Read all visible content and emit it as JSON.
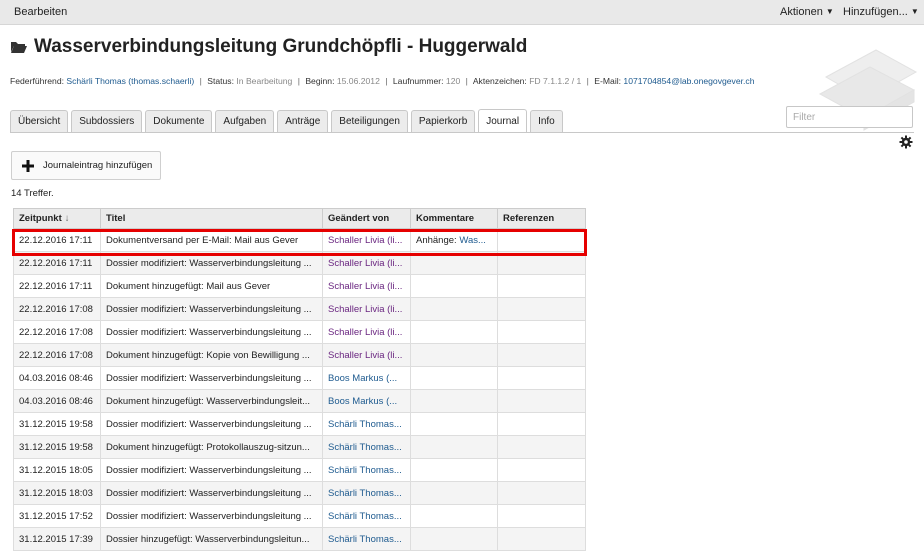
{
  "topbar": {
    "edit_label": "Bearbeiten",
    "actions_label": "Aktionen",
    "add_label": "Hinzufügen..."
  },
  "page": {
    "title": "Wasserverbindungsleitung Grundchöpfli - Huggerwald"
  },
  "meta": {
    "lead_label": "Federführend:",
    "lead_value": "Schärli Thomas (thomas.schaerli)",
    "status_label": "Status:",
    "status_value": "In Bearbeitung",
    "start_label": "Beginn:",
    "start_value": "15.06.2012",
    "number_label": "Laufnummer:",
    "number_value": "120",
    "ref_label": "Aktenzeichen:",
    "ref_value": "FD 7.1.1.2 / 1",
    "email_label": "E-Mail:",
    "email_value": "1071704854@lab.onegovgever.ch"
  },
  "tabs": [
    {
      "label": "Übersicht",
      "active": false
    },
    {
      "label": "Subdossiers",
      "active": false
    },
    {
      "label": "Dokumente",
      "active": false
    },
    {
      "label": "Aufgaben",
      "active": false
    },
    {
      "label": "Anträge",
      "active": false
    },
    {
      "label": "Beteiligungen",
      "active": false
    },
    {
      "label": "Papierkorb",
      "active": false
    },
    {
      "label": "Journal",
      "active": true
    },
    {
      "label": "Info",
      "active": false
    }
  ],
  "filter": {
    "placeholder": "Filter"
  },
  "add_button": {
    "label": "Journaleintrag hinzufügen"
  },
  "hits": "14 Treffer.",
  "table": {
    "columns": [
      "Zeitpunkt",
      "Titel",
      "Geändert von",
      "Kommentare",
      "Referenzen"
    ],
    "sort_indicator": "↓",
    "rows": [
      {
        "time": "22.12.2016 17:11",
        "title": "Dokumentversand per E-Mail: Mail aus Gever",
        "changed_by": "Schaller Livia (li...",
        "comment_label": "Anhänge:",
        "comment_link": "Was...",
        "refs": ""
      },
      {
        "time": "22.12.2016 17:11",
        "title": "Dossier modifiziert: Wasserverbindungsleitung ...",
        "changed_by": "Schaller Livia (li...",
        "comment_label": "",
        "comment_link": "",
        "refs": ""
      },
      {
        "time": "22.12.2016 17:11",
        "title": "Dokument hinzugefügt: Mail aus Gever",
        "changed_by": "Schaller Livia (li...",
        "comment_label": "",
        "comment_link": "",
        "refs": ""
      },
      {
        "time": "22.12.2016 17:08",
        "title": "Dossier modifiziert: Wasserverbindungsleitung ...",
        "changed_by": "Schaller Livia (li...",
        "comment_label": "",
        "comment_link": "",
        "refs": ""
      },
      {
        "time": "22.12.2016 17:08",
        "title": "Dossier modifiziert: Wasserverbindungsleitung ...",
        "changed_by": "Schaller Livia (li...",
        "comment_label": "",
        "comment_link": "",
        "refs": ""
      },
      {
        "time": "22.12.2016 17:08",
        "title": "Dokument hinzugefügt: Kopie von Bewilligung ...",
        "changed_by": "Schaller Livia (li...",
        "comment_label": "",
        "comment_link": "",
        "refs": ""
      },
      {
        "time": "04.03.2016 08:46",
        "title": "Dossier modifiziert: Wasserverbindungsleitung ...",
        "changed_by": "Boos Markus (...",
        "comment_label": "",
        "comment_link": "",
        "refs": ""
      },
      {
        "time": "04.03.2016 08:46",
        "title": "Dokument hinzugefügt: Wasserverbindungsleit...",
        "changed_by": "Boos Markus (...",
        "comment_label": "",
        "comment_link": "",
        "refs": ""
      },
      {
        "time": "31.12.2015 19:58",
        "title": "Dossier modifiziert: Wasserverbindungsleitung ...",
        "changed_by": "Schärli Thomas...",
        "comment_label": "",
        "comment_link": "",
        "refs": ""
      },
      {
        "time": "31.12.2015 19:58",
        "title": "Dokument hinzugefügt: Protokollauszug-sitzun...",
        "changed_by": "Schärli Thomas...",
        "comment_label": "",
        "comment_link": "",
        "refs": ""
      },
      {
        "time": "31.12.2015 18:05",
        "title": "Dossier modifiziert: Wasserverbindungsleitung ...",
        "changed_by": "Schärli Thomas...",
        "comment_label": "",
        "comment_link": "",
        "refs": ""
      },
      {
        "time": "31.12.2015 18:03",
        "title": "Dossier modifiziert: Wasserverbindungsleitung ...",
        "changed_by": "Schärli Thomas...",
        "comment_label": "",
        "comment_link": "",
        "refs": ""
      },
      {
        "time": "31.12.2015 17:52",
        "title": "Dossier modifiziert: Wasserverbindungsleitung ...",
        "changed_by": "Schärli Thomas...",
        "comment_label": "",
        "comment_link": "",
        "refs": ""
      },
      {
        "time": "31.12.2015 17:39",
        "title": "Dossier hinzugefügt: Wasserverbindungsleitun...",
        "changed_by": "Schärli Thomas...",
        "comment_label": "",
        "comment_link": "",
        "refs": ""
      }
    ]
  },
  "colors": {
    "link": "#205c90",
    "visited_link": "#6a2680",
    "highlight": "#e60000"
  }
}
